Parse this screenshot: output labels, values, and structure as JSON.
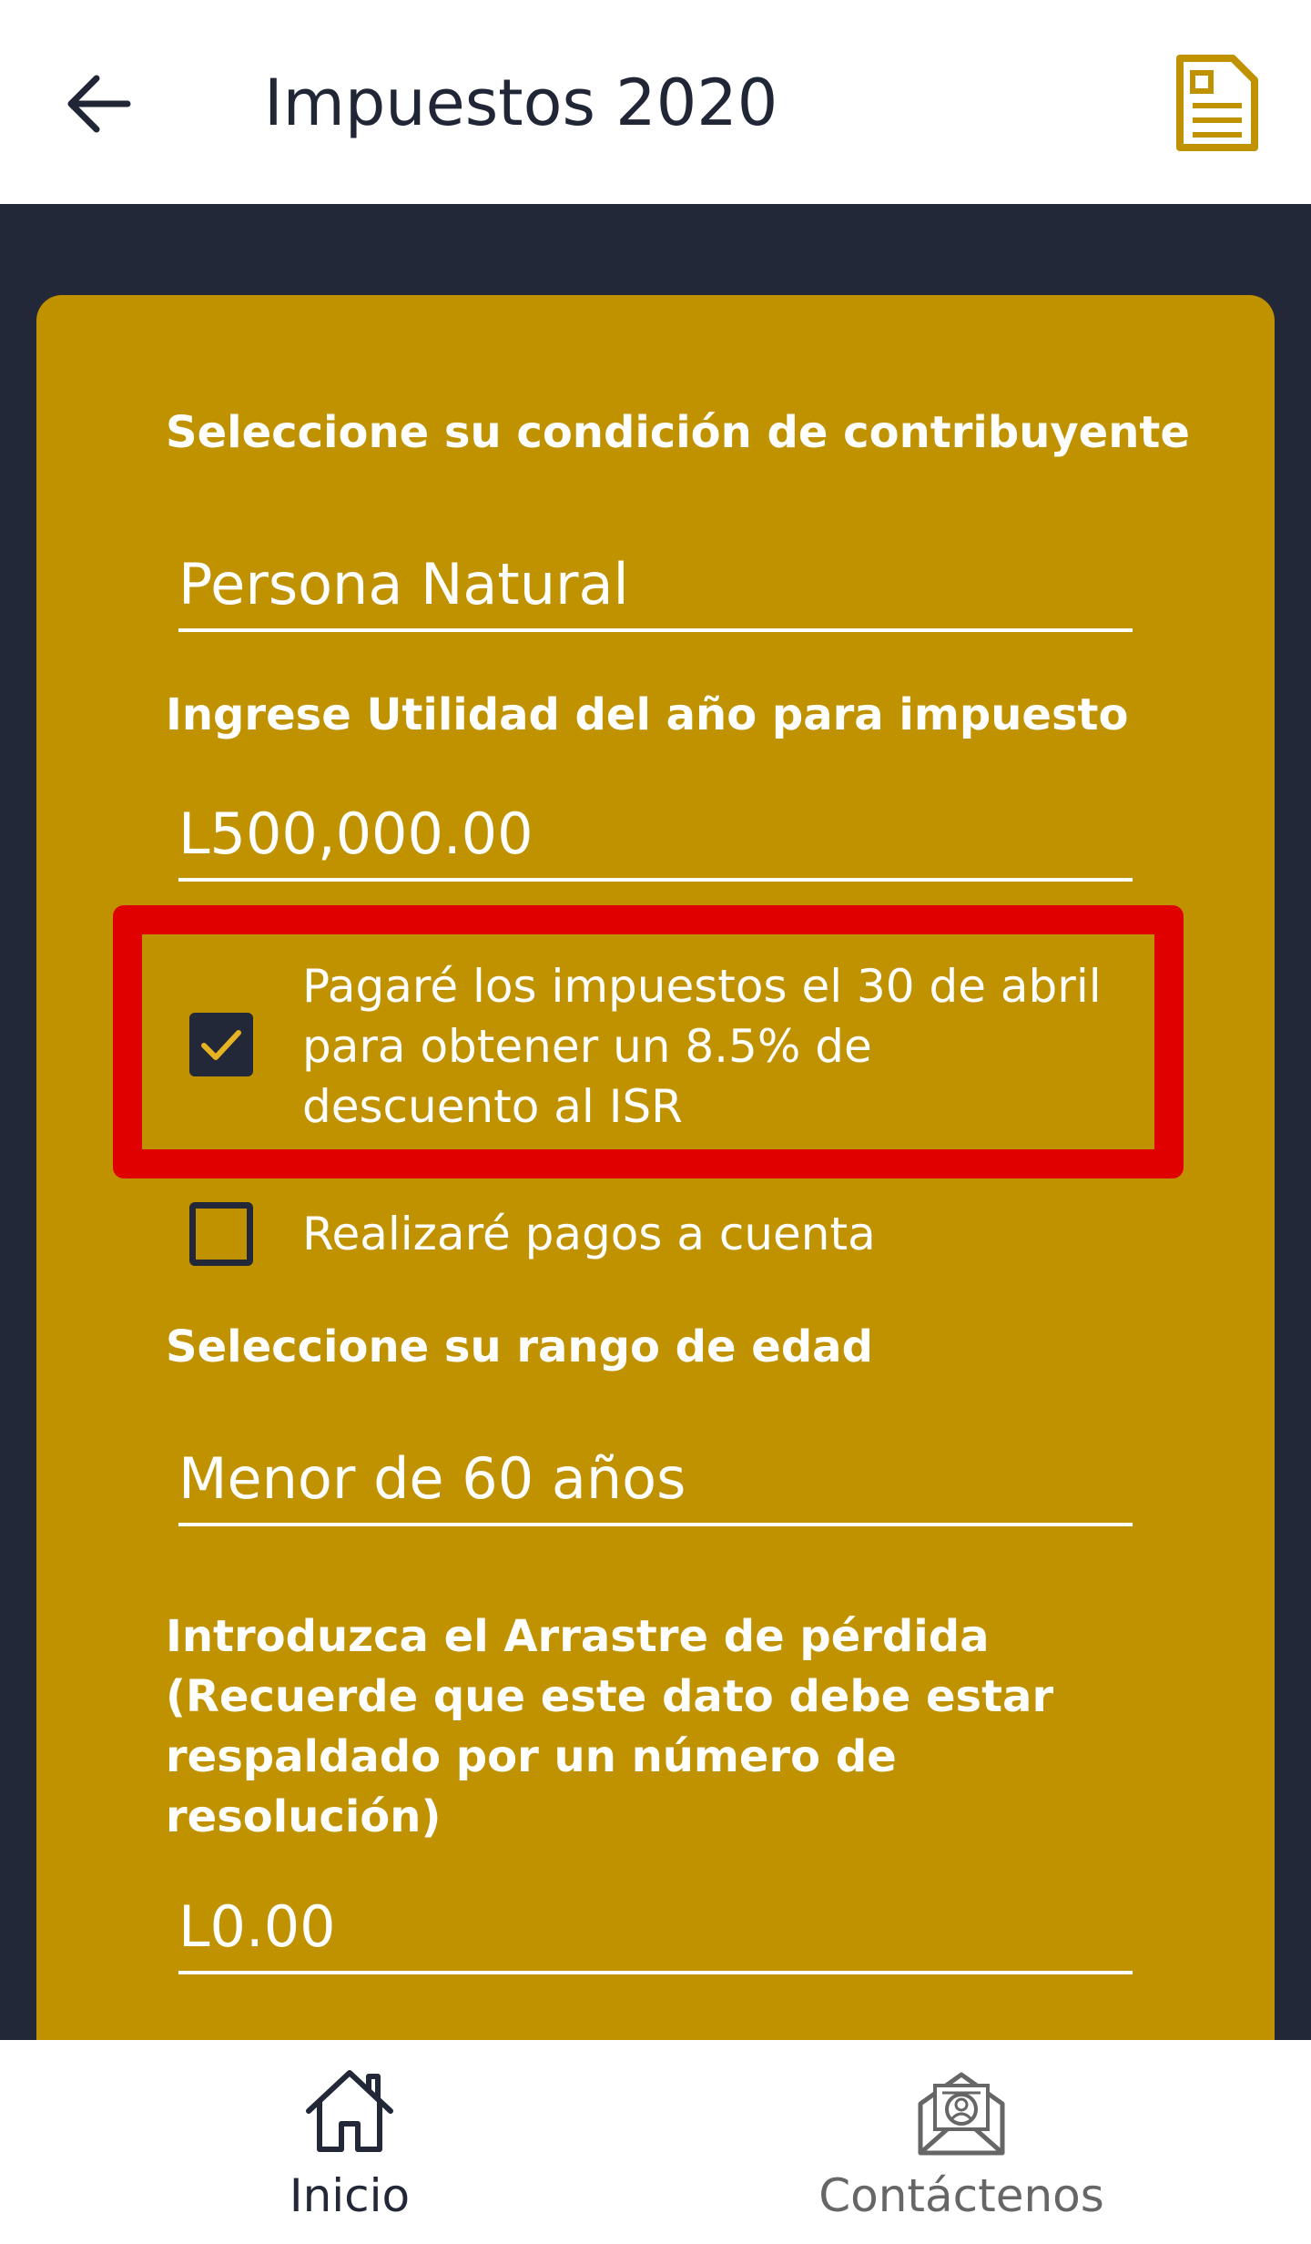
{
  "header": {
    "title": "Impuestos 2020",
    "back_icon": "arrow-left-icon",
    "doc_icon": "document-icon",
    "accent": "#c19200"
  },
  "form": {
    "condition_label": "Seleccione su condición de contribuyente",
    "condition_value": "Persona Natural",
    "income_label": "Ingrese Utilidad del año para impuesto",
    "income_value": "L500,000.00",
    "discount_checkbox": {
      "checked": true,
      "label": "Pagaré los impuestos el 30 de abril para obtener un 8.5% de descuento al ISR"
    },
    "advance_checkbox": {
      "checked": false,
      "label": "Realizaré pagos a cuenta"
    },
    "age_label": "Seleccione su rango de edad",
    "age_value": "Menor de 60 años",
    "loss_label": "Introduzca el Arrastre de pérdida (Recuerde que este dato debe estar respaldado por un número de resolución)",
    "loss_value": "L0.00"
  },
  "nav": {
    "home_label": "Inicio",
    "contact_label": "Contáctenos",
    "home_icon": "home-icon",
    "contact_icon": "contact-mail-icon"
  },
  "colors": {
    "card": "#c19200",
    "dark": "#232838",
    "highlight": "#e10000"
  }
}
